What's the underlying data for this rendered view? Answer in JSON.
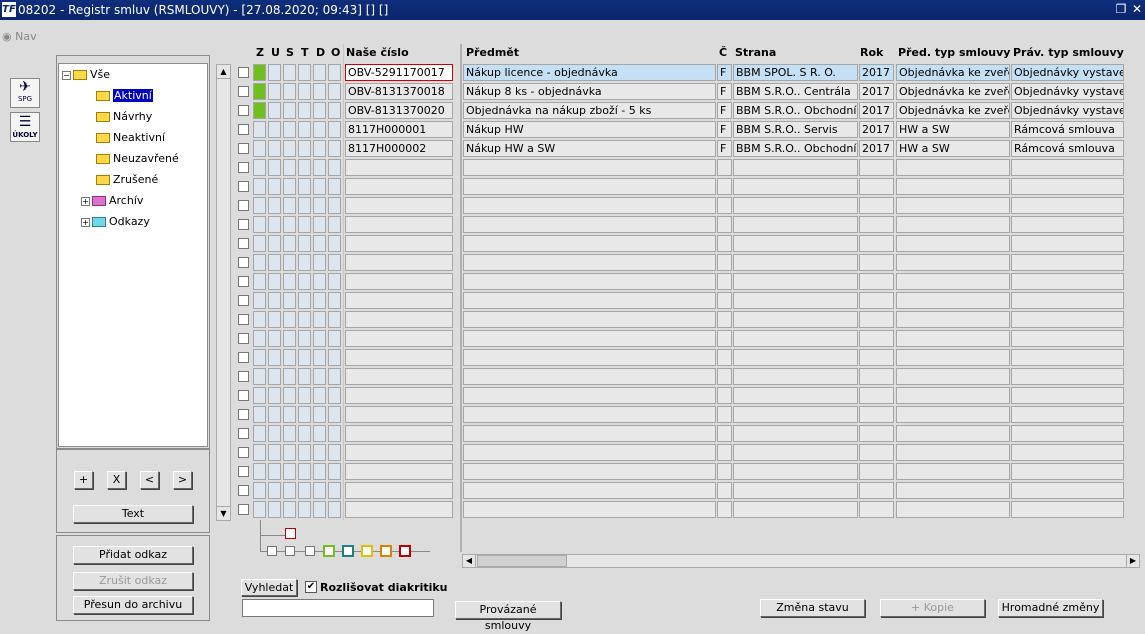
{
  "window": {
    "title": "08202 - Registr smluv (RSMLOUVY) - [27.08.2020; 09:43]  [] []",
    "logo": "TF"
  },
  "nav": {
    "label": "Nav"
  },
  "toolbar": {
    "spg_label": "SPG",
    "ukoly_label": "ÚKOLY"
  },
  "tree": {
    "items": [
      {
        "label": "Vše"
      },
      {
        "label": "Aktivní"
      },
      {
        "label": "Návrhy"
      },
      {
        "label": "Neaktivní"
      },
      {
        "label": "Neuzavřené"
      },
      {
        "label": "Zrušené"
      },
      {
        "label": "Archív"
      },
      {
        "label": "Odkazy"
      }
    ]
  },
  "tree_buttons": {
    "plus": "+",
    "x": "X",
    "left": "<",
    "right": ">",
    "text": "Text"
  },
  "link_buttons": {
    "add": "Přidat odkaz",
    "cancel": "Zrušit odkaz",
    "move": "Přesun do archivu"
  },
  "columns": {
    "z": "Z",
    "u": "U",
    "s": "S",
    "t": "T",
    "d": "D",
    "o": "O",
    "nase_cislo": "Naše číslo",
    "predmet": "Předmět",
    "c": "Č",
    "strana": "Strana",
    "rok": "Rok",
    "pred_typ": "Před. typ smlouvy",
    "prav_typ": "Práv. typ smlouvy"
  },
  "rows": [
    {
      "cislo": "OBV-5291170017",
      "predmet": "Nákup licence - objednávka",
      "c": "F",
      "strana": "BBM SPOL. S R. O.",
      "rok": "2017",
      "pred_typ": "Objednávka ke zveřejn",
      "prav_typ": "Objednávky vystavené"
    },
    {
      "cislo": "OBV-8131370018",
      "predmet": "Nákup 8 ks - objednávka",
      "c": "F",
      "strana": "BBM S.R.O.. Centrála",
      "rok": "2017",
      "pred_typ": "Objednávka ke zveřejn",
      "prav_typ": "Objednávky vystavené"
    },
    {
      "cislo": "OBV-8131370020",
      "predmet": "Objednávka na nákup zboží - 5 ks",
      "c": "F",
      "strana": "BBM S.R.O.. Obchodní oc",
      "rok": "2017",
      "pred_typ": "Objednávka ke zveřejn",
      "prav_typ": "Objednávky vystavené"
    },
    {
      "cislo": "8117H000001",
      "predmet": "Nákup HW",
      "c": "F",
      "strana": "BBM S.R.O.. Servis",
      "rok": "2017",
      "pred_typ": "HW a SW",
      "prav_typ": "Rámcová smlouva"
    },
    {
      "cislo": "8117H000002",
      "predmet": "Nákup HW a SW",
      "c": "F",
      "strana": "BBM S.R.O.. Obchodní oc",
      "rok": "2017",
      "pred_typ": "HW a SW",
      "prav_typ": "Rámcová smlouva"
    }
  ],
  "search": {
    "button": "Vyhledat",
    "diacritics_label": "Rozlišovat diakritiku",
    "value": ""
  },
  "bottom_buttons": {
    "linked": "Provázané smlouvy",
    "change_state": "Změna stavu",
    "copy": "+ Kopie",
    "bulk": "Hromadné změny"
  },
  "colors": {
    "titlebar": "#0a246a",
    "selected": "#0000c0",
    "highlight": "#c5dff4",
    "green": "#6fbf1f"
  }
}
